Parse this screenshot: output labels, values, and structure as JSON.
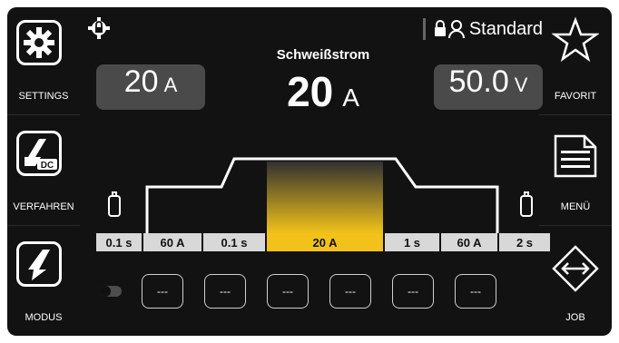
{
  "sidebar_left": [
    {
      "label": "SETTINGS",
      "icon": "gear-icon"
    },
    {
      "label": "VERFAHREN",
      "icon": "welding-torch-dc-icon",
      "badge": "DC"
    },
    {
      "label": "MODUS",
      "icon": "pencil-icon"
    }
  ],
  "sidebar_right": [
    {
      "label": "FAVORIT",
      "icon": "star-icon"
    },
    {
      "label": "MENÜ",
      "icon": "menu-document-icon"
    },
    {
      "label": "JOB",
      "icon": "job-arrows-icon"
    }
  ],
  "header": {
    "user_mode": "Standard",
    "top_left_icon": "gear-lock-icon"
  },
  "current": {
    "title": "Schweißstrom",
    "value": "20",
    "unit": "A"
  },
  "left_box": {
    "value": "20",
    "unit": "A"
  },
  "right_box": {
    "value": "50.0",
    "unit": "V"
  },
  "timeline": [
    {
      "text": "0.1 s"
    },
    {
      "text": "60 A"
    },
    {
      "text": "0.1 s"
    },
    {
      "text": "20 A"
    },
    {
      "text": "1 s"
    },
    {
      "text": "60 A"
    },
    {
      "text": "2 s"
    }
  ],
  "programs": [
    "---",
    "---",
    "---",
    "---",
    "---",
    "---"
  ],
  "colors": {
    "accent": "#f2c21a",
    "panel": "#4a4a4a",
    "background": "#121212"
  }
}
